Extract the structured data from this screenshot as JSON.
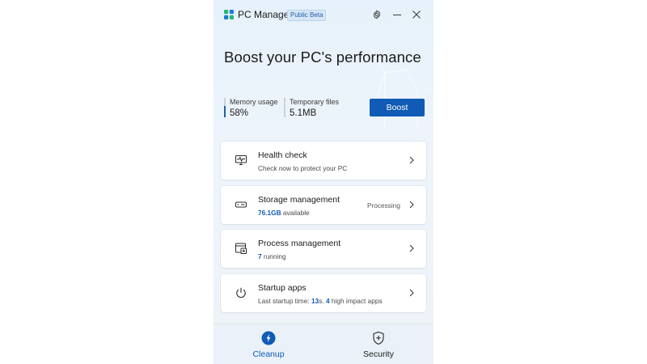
{
  "app": {
    "title": "PC Manager",
    "badge": "Public Beta"
  },
  "titlebar": {
    "settings_icon": "gear-icon",
    "minimize_icon": "minimize-icon",
    "close_icon": "close-icon"
  },
  "hero": {
    "title": "Boost your PC's performance"
  },
  "stats": {
    "memory": {
      "label": "Memory usage",
      "value": "58%",
      "fill_fraction": 0.58
    },
    "temp": {
      "label": "Temporary files",
      "value": "5.1MB"
    }
  },
  "boost": {
    "label": "Boost"
  },
  "cards": [
    {
      "icon": "monitor-heartbeat-icon",
      "title": "Health check",
      "sub_plain": "Check now to protect your PC"
    },
    {
      "icon": "storage-drive-icon",
      "title": "Storage management",
      "sub_bold": "76.1GB",
      "sub_rest": " available",
      "status": "Processing"
    },
    {
      "icon": "process-window-icon",
      "title": "Process management",
      "sub_bold": "7",
      "sub_rest": " running"
    },
    {
      "icon": "power-icon",
      "title": "Startup apps",
      "sub_prefix": "Last startup time: ",
      "sub_bold1": "13",
      "sub_mid": "s. ",
      "sub_bold2": "4",
      "sub_suffix": " high impact apps"
    }
  ],
  "nav": {
    "cleanup": "Cleanup",
    "security": "Security"
  },
  "colors": {
    "accent": "#0f5bb5",
    "logo_green": "#2bb673",
    "logo_blue": "#1f7ad6"
  }
}
